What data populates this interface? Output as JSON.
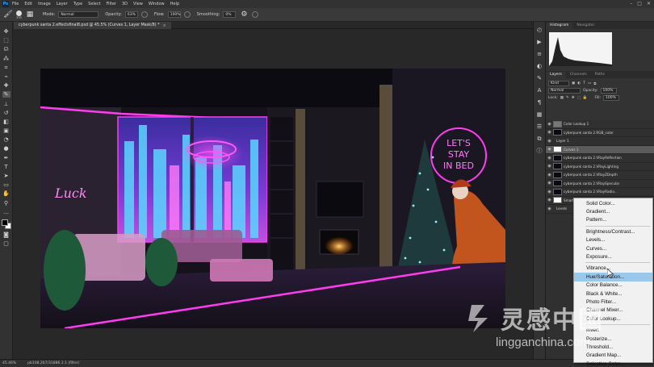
{
  "menubar": {
    "logo": "Ps",
    "items": [
      "File",
      "Edit",
      "Image",
      "Layer",
      "Type",
      "Select",
      "Filter",
      "3D",
      "View",
      "Window",
      "Help"
    ],
    "window_controls": [
      "–",
      "□",
      "✕"
    ]
  },
  "options": {
    "brush_size": "335",
    "mode_label": "Mode:",
    "mode_value": "Normal",
    "opacity_label": "Opacity:",
    "opacity_value": "63%",
    "flow_label": "Flow:",
    "flow_value": "100%",
    "smoothing_label": "Smoothing:",
    "smoothing_value": "0%"
  },
  "document": {
    "tab_title": "cyberpunk santa 2.effectsfinal8.psd @ 45.5% (Curves 1, Layer Mask/8) *",
    "close": "×"
  },
  "artwork": {
    "neon_sign": [
      "LET'S",
      "STAY",
      "IN BED"
    ],
    "wall_sign": "Luck"
  },
  "statusbar": {
    "zoom": "45.46%",
    "doc_info": "pb108.267/31886.3.1 (filter)"
  },
  "panels": {
    "top_tabs": [
      "Histogram",
      "Navigator"
    ],
    "layer_tabs": [
      "Layers",
      "Channels",
      "Paths"
    ],
    "kind_label": "Kind",
    "blend_mode": "Normal",
    "opacity_label": "Opacity:",
    "opacity_value": "100%",
    "lock_label": "Lock:",
    "fill_label": "Fill:",
    "fill_value": "100%"
  },
  "layers": [
    {
      "name": "Color Lookup 1",
      "thumb": "adj",
      "selected": false
    },
    {
      "name": "cyberpunk santa 2.RGB_color",
      "thumb": "img",
      "selected": false
    },
    {
      "name": "Layer 1",
      "thumb": "none",
      "selected": false
    },
    {
      "name": "Curves 1",
      "thumb": "mask",
      "selected": true
    },
    {
      "name": "cyberpunk santa 2.VRayReflection",
      "thumb": "img",
      "selected": false
    },
    {
      "name": "cyberpunk santa 2.VRayLighting",
      "thumb": "img",
      "selected": false
    },
    {
      "name": "cyberpunk santa 2.VRayZDepth",
      "thumb": "img",
      "selected": false
    },
    {
      "name": "cyberpunk santa 2.VRaySpecular",
      "thumb": "img",
      "selected": false
    },
    {
      "name": "cyberpunk santa 2.VRayRadio...",
      "thumb": "img",
      "selected": false
    },
    {
      "name": "Smart Filters",
      "thumb": "mask",
      "selected": false
    },
    {
      "name": "Levels",
      "thumb": "none",
      "selected": false
    }
  ],
  "context_menu": {
    "groups": [
      [
        "Solid Color...",
        "Gradient...",
        "Pattern..."
      ],
      [
        "Brightness/Contrast...",
        "Levels...",
        "Curves...",
        "Exposure..."
      ],
      [
        "Vibrance...",
        "Hue/Saturation...",
        "Color Balance...",
        "Black & White...",
        "Photo Filter...",
        "Channel Mixer...",
        "Color Lookup..."
      ],
      [
        "Invert",
        "Posterize...",
        "Threshold...",
        "Gradient Map...",
        "Selective Color..."
      ]
    ],
    "hovered": "Hue/Saturation..."
  },
  "watermark": {
    "cn": "灵感中国",
    "en": "lingganchina.com"
  },
  "colors": {
    "neon_pink": "#ff3cf0",
    "neon_magenta": "#d02cff",
    "menu_hover": "#9ac8ec",
    "ps_blue": "#31a8ff"
  }
}
